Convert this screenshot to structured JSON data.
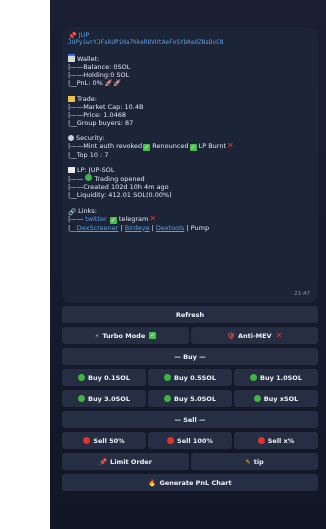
{
  "token": {
    "name": "JUP",
    "address": "JUPyiwrYJFskUPiHa7hkeR8VUtAeFoSYbKedZNsDvCN"
  },
  "wallet": {
    "title": "Wallet:",
    "balance": "|——Balance: 0SOL",
    "holding": "|——Holding:0 SOL",
    "pnl": "|__PnL: 0%"
  },
  "trade": {
    "title": "Trade:",
    "market_cap": "|——Market Cap: 10.4B",
    "price": "|——Price: 1.0468",
    "group_buyers": "|__Group buyers: 87"
  },
  "security": {
    "title": "Security:",
    "line1_prefix": "|——Mint auth revoked",
    "renounced": "Renounced",
    "lp_burnt": "LP Burnt",
    "top10": "|__Top 10 : 7"
  },
  "lp": {
    "title": "LP: JUP-SOL",
    "trading": "Trading opened",
    "created": "|——Created 102d 10h 4m ago",
    "liquidity": "|__Liquidity: 412.01 SOL(0.00%)"
  },
  "links": {
    "title": "Links:",
    "prefix1": "|—— ",
    "twitter": "twitter",
    "telegram": "telegram",
    "prefix2": "|__",
    "dexscreener": "DexScreener",
    "birdeye": "Birdeye",
    "dextools": "Dextools",
    "pump": "Pump",
    "sep": " | "
  },
  "time": "21:47",
  "buttons": {
    "refresh": "Refresh",
    "turbo": "Turbo Mode",
    "antimev": "Anti-MEV",
    "buy_header": "— Buy —",
    "buy_01": "Buy 0.1SOL",
    "buy_05": "Buy 0.5SOL",
    "buy_10": "Buy 1.0SOL",
    "buy_30": "Buy 3.0SOL",
    "buy_50": "Buy 5.0SOL",
    "buy_x": "Buy xSOL",
    "sell_header": "— Sell —",
    "sell_50": "Sell 50%",
    "sell_100": "Sell 100%",
    "sell_x": "Sell x%",
    "limit": "Limit Order",
    "tip": "tip",
    "pnl_chart": "Generate PnL Chart"
  }
}
